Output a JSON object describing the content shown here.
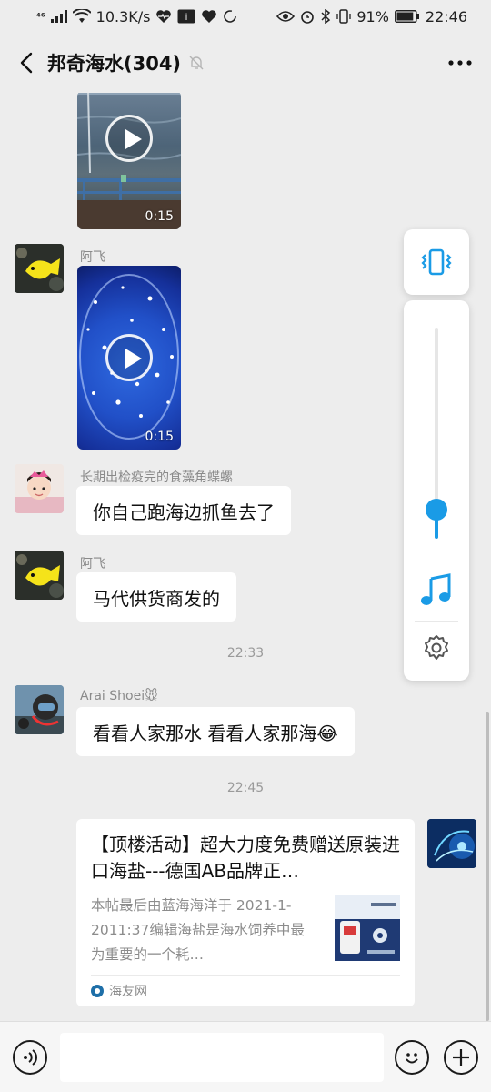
{
  "status_bar": {
    "network": "⁴⁶",
    "speed": "10.3K/s",
    "battery": "91%",
    "time": "22:46",
    "battery_level": 0.91
  },
  "header": {
    "title": "邦奇海水(304)"
  },
  "messages": {
    "video1": {
      "duration": "0:15"
    },
    "msg2": {
      "sender": "阿飞",
      "duration": "0:15"
    },
    "msg3": {
      "sender": "长期出检疫完的食藻角蝶螺",
      "text": "你自己跑海边抓鱼去了"
    },
    "msg4": {
      "sender": "阿飞",
      "text": "马代供货商发的"
    },
    "time1": "22:33",
    "msg5": {
      "sender": "Arai Shoei🐭",
      "text": "看看人家那水 看看人家那海😂"
    },
    "time2": "22:45",
    "card": {
      "title": "【顶楼活动】超大力度免费赠送原装进口海盐---德国AB品牌正…",
      "description": "本帖最后由蓝海海洋于 2021-1-2011:37编辑海盐是海水饲养中最为重要的一个耗…",
      "source": "海友网"
    }
  },
  "volume_panel": {
    "level": 0.14
  },
  "input_bar": {
    "value": ""
  },
  "colors": {
    "accent": "#1a9be6",
    "background": "#ededed",
    "bubble": "#ffffff"
  }
}
